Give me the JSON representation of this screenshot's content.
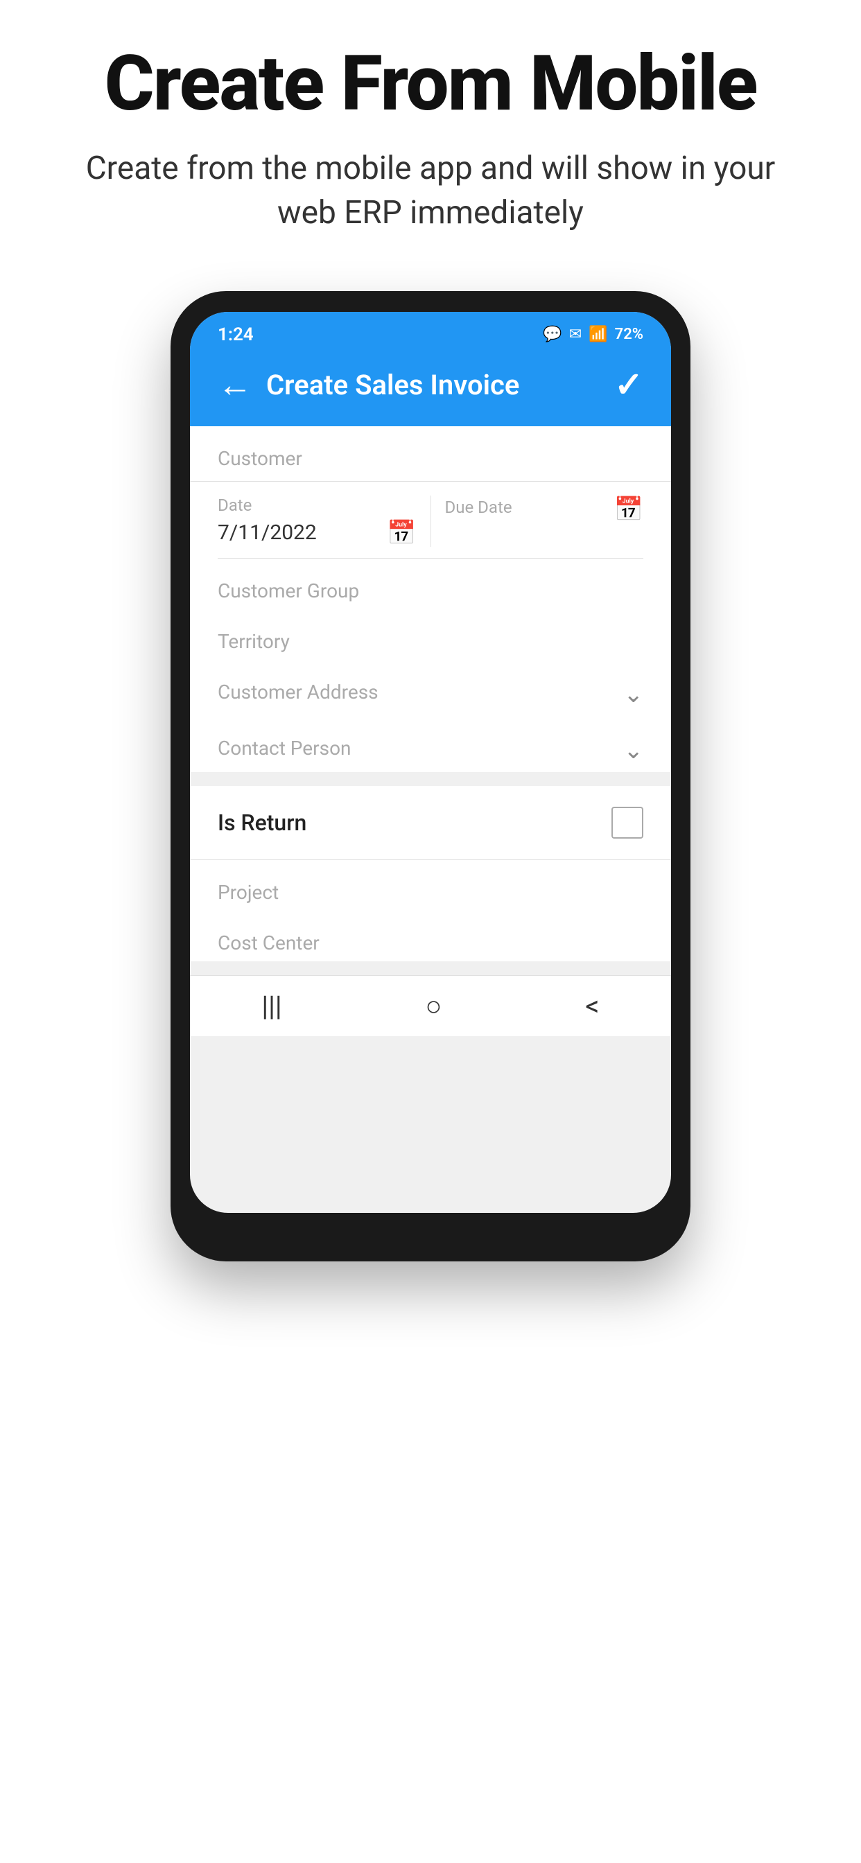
{
  "page": {
    "title": "Create From Mobile",
    "subtitle": "Create from the mobile app and will show in your web ERP immediately"
  },
  "statusBar": {
    "time": "1:24",
    "battery": "72%"
  },
  "appHeader": {
    "title": "Create Sales Invoice",
    "backIcon": "←",
    "checkIcon": "✓"
  },
  "form": {
    "customerLabel": "Customer",
    "dateLabel": "Date",
    "dateValue": "7/11/2022",
    "dueDateLabel": "Due Date",
    "customerGroupLabel": "Customer Group",
    "territoryLabel": "Territory",
    "customerAddressLabel": "Customer Address",
    "contactPersonLabel": "Contact Person",
    "isReturnLabel": "Is Return",
    "projectLabel": "Project",
    "costCenterLabel": "Cost Center"
  },
  "icons": {
    "back": "←",
    "check": "✓",
    "calendar": "📅",
    "chevronDown": "⌄",
    "navBar": "|||",
    "navHome": "○",
    "navBack": "<"
  }
}
